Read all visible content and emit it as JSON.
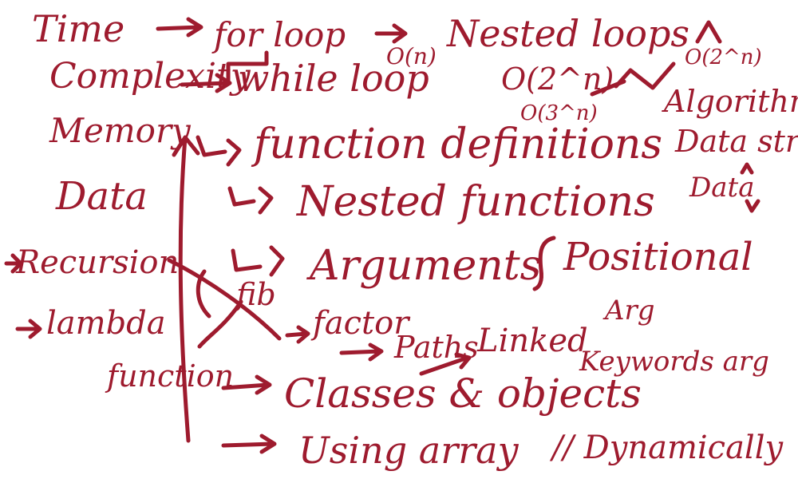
{
  "notes": {
    "time": "Time",
    "complexity": "Complexity",
    "for_loop": "for loop",
    "on": "O(n)",
    "nested_loops": "Nested loops",
    "o2n_top": "O(2^n)",
    "while_loop": "while loop",
    "o2n_mid": "O(2^n)",
    "o3n": "O(3^n)",
    "algorithms": "Algorithms",
    "memory": "Memory",
    "function_definitions": "function definitions",
    "data_structures": "Data stru",
    "data": "Data",
    "nested_functions": "Nested functions",
    "data_right": "Data",
    "recursion": "Recursion",
    "arguments": "Arguments",
    "positional": "Positional",
    "arg": "Arg",
    "fib": "fib",
    "lambda": "lambda",
    "function": "function",
    "factor": "factor",
    "paths": "Paths",
    "linked": "Linked",
    "keywords": "Keywords arg",
    "classes_objects": "Classes & objects",
    "using_array": "Using array",
    "dynamically": "// Dynamically"
  },
  "ink_color": "#9e1b2e"
}
